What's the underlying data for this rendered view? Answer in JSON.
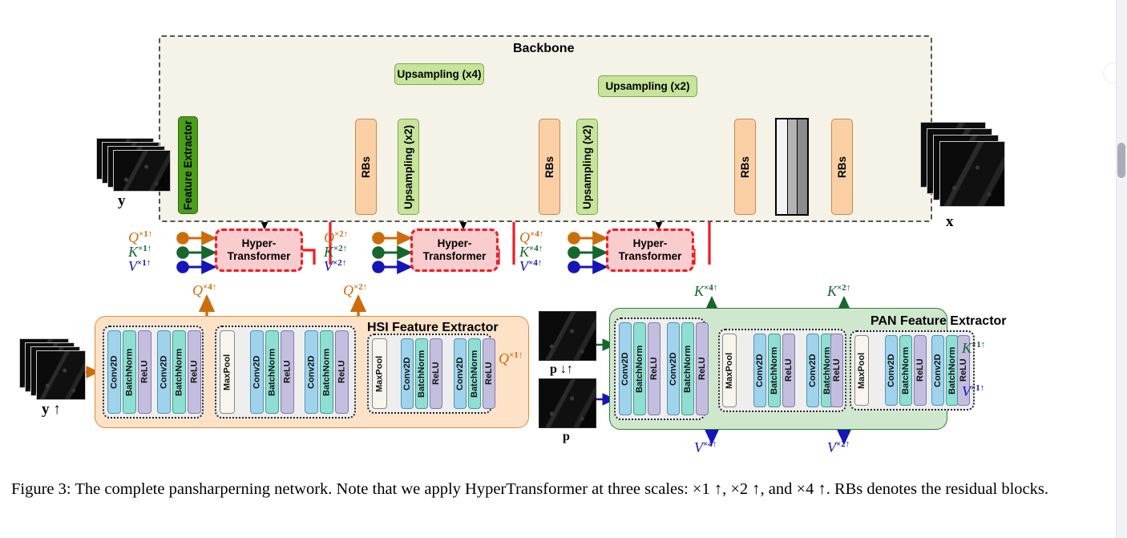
{
  "figure": {
    "caption": "Figure 3: The complete pansharperning network. Note that we apply HyperTransformer at three scales: ×1 ↑, ×2 ↑, and ×4 ↑. RBs denotes the residual blocks.",
    "caption_label": "Figure 3:"
  },
  "backbone": {
    "title": "Backbone",
    "feature_extractor": "Feature Extractor",
    "rbs": "RBs",
    "upsampling_x2": "Upsampling (x2)",
    "upsampling_x4": "Upsampling (x4)",
    "blocks": [
      {
        "label": "Feature Extractor",
        "kind": "feature-extractor"
      },
      {
        "label": "RBs",
        "kind": "residual-blocks"
      },
      {
        "label": "Upsampling (x2)",
        "kind": "upsampling"
      },
      {
        "label": "RBs",
        "kind": "residual-blocks"
      },
      {
        "label": "Upsampling (x2)",
        "kind": "upsampling"
      },
      {
        "label": "RBs",
        "kind": "residual-blocks"
      },
      {
        "label": "RBs",
        "kind": "residual-blocks"
      }
    ],
    "skip_upsampling": [
      {
        "label": "Upsampling (x4)"
      },
      {
        "label": "Upsampling (x2)"
      }
    ],
    "concat": {
      "label": ""
    }
  },
  "io": {
    "input_hsi": "y",
    "output": "x",
    "hsi_up": "y ↑",
    "pan_downup": "p ↓↑",
    "pan": "p"
  },
  "hyper_transformers": [
    {
      "title_line1": "Hyper-",
      "title_line2": "Transformer",
      "q": "Q",
      "k": "K",
      "v": "V",
      "scale": "×1↑"
    },
    {
      "title_line1": "Hyper-",
      "title_line2": "Transformer",
      "q": "Q",
      "k": "K",
      "v": "V",
      "scale": "×2↑"
    },
    {
      "title_line1": "Hyper-",
      "title_line2": "Transformer",
      "q": "Q",
      "k": "K",
      "v": "V",
      "scale": "×4↑"
    }
  ],
  "hsi_extractor": {
    "title": "HSI Feature Extractor",
    "outputs": [
      {
        "symbol": "Q",
        "scale": "×4↑"
      },
      {
        "symbol": "Q",
        "scale": "×2↑"
      },
      {
        "symbol": "Q",
        "scale": "×1↑"
      }
    ],
    "stages": [
      {
        "layers": [
          "Conv2D",
          "BatchNorm",
          "ReLU",
          "Conv2D",
          "BatchNorm",
          "ReLU"
        ]
      },
      {
        "layers": [
          "MaxPool",
          "Conv2D",
          "BatchNorm",
          "ReLU",
          "Conv2D",
          "BatchNorm",
          "ReLU"
        ]
      },
      {
        "layers": [
          "MaxPool",
          "Conv2D",
          "BatchNorm",
          "ReLU",
          "Conv2D",
          "BatchNorm",
          "ReLU"
        ]
      }
    ]
  },
  "pan_extractor": {
    "title": "PAN Feature Extractor",
    "outputs_k": [
      {
        "symbol": "K",
        "scale": "×4↑"
      },
      {
        "symbol": "K",
        "scale": "×2↑"
      },
      {
        "symbol": "K",
        "scale": "×1↑"
      }
    ],
    "outputs_v": [
      {
        "symbol": "V",
        "scale": "×4↑"
      },
      {
        "symbol": "V",
        "scale": "×2↑"
      },
      {
        "symbol": "V",
        "scale": "×1↑"
      }
    ],
    "stages": [
      {
        "layers": [
          "Conv2D",
          "BatchNorm",
          "ReLU",
          "Conv2D",
          "BatchNorm",
          "ReLU"
        ]
      },
      {
        "layers": [
          "MaxPool",
          "Conv2D",
          "BatchNorm",
          "ReLU",
          "Conv2D",
          "BatchNorm",
          "ReLU"
        ]
      },
      {
        "layers": [
          "MaxPool",
          "Conv2D",
          "BatchNorm",
          "ReLU",
          "Conv2D",
          "BatchNorm",
          "ReLU"
        ]
      }
    ]
  },
  "colors": {
    "backbone_bg": "#f5f2e8",
    "feature_extractor": "#4a9e18",
    "upsampling": "#c6e49a",
    "residual_blocks": "#fbcfa4",
    "hyper_transformer_fill": "#f9ccce",
    "hyper_transformer_border": "#ee1c25",
    "hsi_panel": "#fde2c8",
    "pan_panel": "#cfe8cd",
    "conv2d": "#9fd3ec",
    "batchnorm": "#8fded3",
    "relu": "#c3bede",
    "maxpool": "#f7f5ee",
    "query_arrow": "#cc6d0b",
    "key_arrow": "#17662e",
    "value_arrow": "#1515b8",
    "residual_arrow": "#ee1c25"
  }
}
